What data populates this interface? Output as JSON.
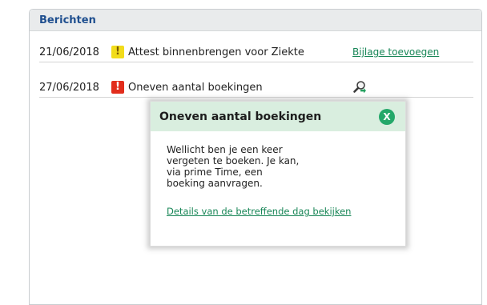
{
  "panel": {
    "title": "Berichten"
  },
  "messages": [
    {
      "date": "21/06/2018",
      "badge": "!",
      "badge_color": "#f2dc1a",
      "title": "Attest binnenbrengen voor Ziekte",
      "action_label": "Bijlage toevoegen"
    },
    {
      "date": "27/06/2018",
      "badge": "!",
      "badge_color": "#e22d1c",
      "title": "Oneven aantal boekingen",
      "action_icon": "zoom-icon"
    }
  ],
  "popup": {
    "title": "Oneven aantal boekingen",
    "close_label": "X",
    "body": "Wellicht ben je een keer vergeten te boeken. Je kan, via prime Time, een boeking aanvragen.",
    "link_label": "Details van de betreffende dag bekijken"
  },
  "colors": {
    "accent_green": "#188657",
    "header_blue": "#1f4f8f",
    "popup_header_bg": "#d9eedf",
    "close_button": "#24a86a"
  }
}
